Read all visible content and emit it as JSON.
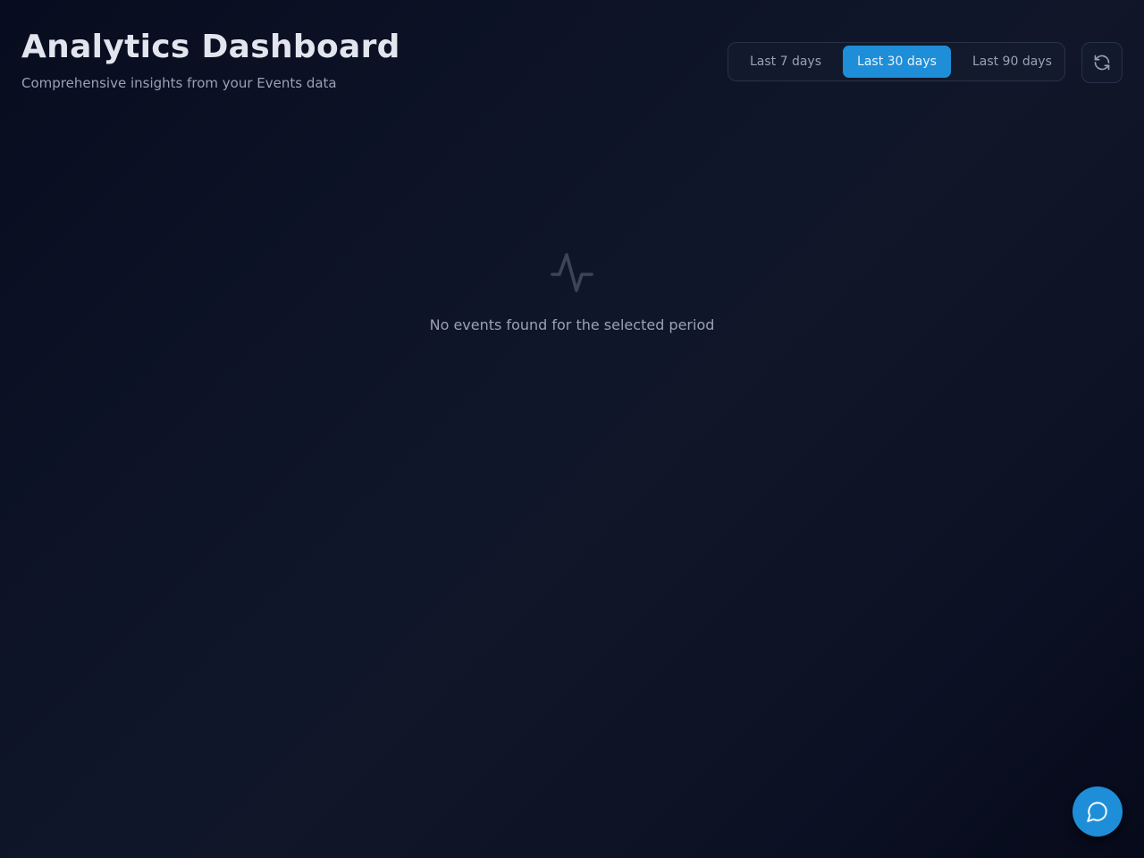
{
  "header": {
    "title": "Analytics Dashboard",
    "subtitle": "Comprehensive insights from your Events data"
  },
  "date_range": {
    "options": [
      {
        "label": "Last 7 days",
        "active": false
      },
      {
        "label": "Last 30 days",
        "active": true
      },
      {
        "label": "Last 90 days",
        "active": false
      }
    ],
    "selected": "Last 30 days"
  },
  "icons": {
    "refresh": "refresh-icon",
    "empty": "activity-icon",
    "chat": "chat-bubble-icon"
  },
  "empty_state": {
    "message": "No events found for the selected period"
  },
  "colors": {
    "accent": "#1e8ed8",
    "background": "#0f1529",
    "text_muted": "#9aa1b4",
    "title": "#e2e5ee"
  }
}
